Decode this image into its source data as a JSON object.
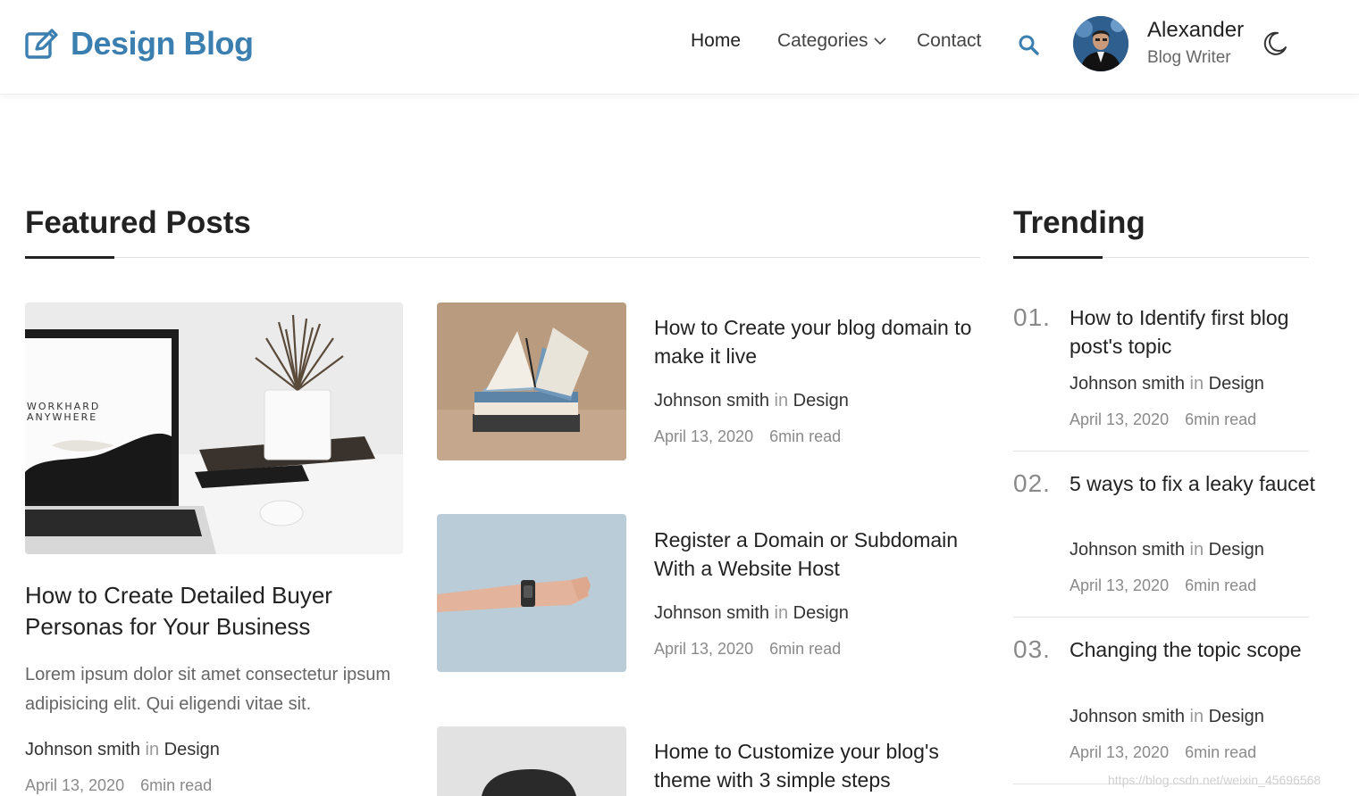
{
  "header": {
    "logo_text": "Design Blog",
    "nav": {
      "home": "Home",
      "categories": "Categories",
      "contact": "Contact"
    },
    "user": {
      "name": "Alexander",
      "role": "Blog Writer"
    },
    "brand_color": "#3b7fb1",
    "icons": [
      "edit-icon",
      "chevron-down-icon",
      "search-icon",
      "moon-icon"
    ]
  },
  "featured": {
    "title": "Featured Posts",
    "main_post": {
      "title": "How to Create Detailed Buyer Personas for Your Business",
      "excerpt": "Lorem ipsum dolor sit amet consectetur ipsum adipisicing elit. Qui eligendi vitae sit.",
      "author": "Johnson smith",
      "in": "in",
      "category": "Design",
      "date": "April 13, 2020",
      "read_time": "6min read",
      "image_text_line1": "WORKHARD",
      "image_text_line2": "ANYWHERE"
    },
    "posts": [
      {
        "title": "How to Create your blog domain to make it live",
        "author": "Johnson smith",
        "in": "in",
        "category": "Design",
        "date": "April 13, 2020",
        "read_time": "6min read"
      },
      {
        "title": "Register a Domain or Subdomain With a Website Host",
        "author": "Johnson smith",
        "in": "in",
        "category": "Design",
        "date": "April 13, 2020",
        "read_time": "6min read"
      },
      {
        "title": "Home to Customize your blog's theme with 3 simple steps"
      }
    ]
  },
  "trending": {
    "title": "Trending",
    "items": [
      {
        "num": "01.",
        "title": "How to Identify first blog post's topic",
        "author": "Johnson smith",
        "in": "in",
        "category": "Design",
        "date": "April 13, 2020",
        "read_time": "6min read"
      },
      {
        "num": "02.",
        "title": "5 ways to fix a leaky faucet",
        "author": "Johnson smith",
        "in": "in",
        "category": "Design",
        "date": "April 13, 2020",
        "read_time": "6min read"
      },
      {
        "num": "03.",
        "title": "Changing the topic scope",
        "author": "Johnson smith",
        "in": "in",
        "category": "Design",
        "date": "April 13, 2020",
        "read_time": "6min read"
      }
    ]
  },
  "watermark": "https://blog.csdn.net/weixin_45696568"
}
